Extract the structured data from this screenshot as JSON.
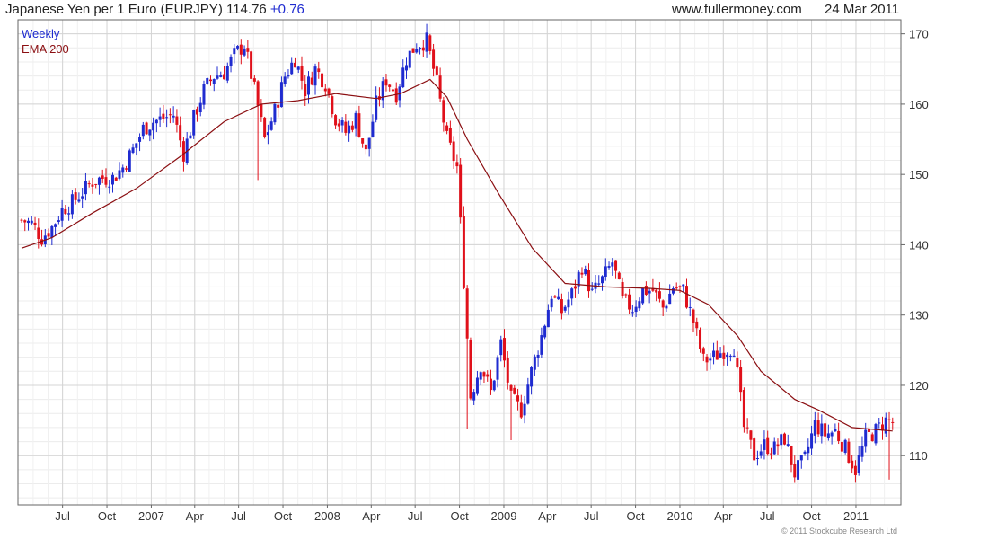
{
  "header": {
    "title": "Japanese Yen per 1 Euro (EURJPY)",
    "last": "114.76",
    "change": "+0.76",
    "site": "www.fullermoney.com",
    "date": "24 Mar 2011"
  },
  "footer": {
    "copyright": "© 2011 Stockcube Research Ltd"
  },
  "colors": {
    "up": "#1f2bd0",
    "down": "#e0101a",
    "ema": "#8b0f12",
    "grid": "#d4d4d4",
    "frame": "#666666"
  },
  "chart_data": {
    "type": "candlestick",
    "legend": [
      "Weekly",
      "EMA 200"
    ],
    "legend_position": "top-left",
    "grid": true,
    "ylim": [
      103,
      172
    ],
    "y_ticks": [
      110,
      120,
      130,
      140,
      150,
      160,
      170
    ],
    "x_ticks": [
      {
        "label": "Jul",
        "date": "2006-07-01"
      },
      {
        "label": "Oct",
        "date": "2006-10-01"
      },
      {
        "label": "2007",
        "date": "2007-01-01"
      },
      {
        "label": "Apr",
        "date": "2007-04-01"
      },
      {
        "label": "Jul",
        "date": "2007-07-01"
      },
      {
        "label": "Oct",
        "date": "2007-10-01"
      },
      {
        "label": "2008",
        "date": "2008-01-01"
      },
      {
        "label": "Apr",
        "date": "2008-04-01"
      },
      {
        "label": "Jul",
        "date": "2008-07-01"
      },
      {
        "label": "Oct",
        "date": "2008-10-01"
      },
      {
        "label": "2009",
        "date": "2009-01-01"
      },
      {
        "label": "Apr",
        "date": "2009-04-01"
      },
      {
        "label": "Jul",
        "date": "2009-07-01"
      },
      {
        "label": "Oct",
        "date": "2009-10-01"
      },
      {
        "label": "2010",
        "date": "2010-01-01"
      },
      {
        "label": "Apr",
        "date": "2010-04-01"
      },
      {
        "label": "Jul",
        "date": "2010-07-01"
      },
      {
        "label": "Oct",
        "date": "2010-10-01"
      },
      {
        "label": "2011",
        "date": "2011-01-01"
      }
    ],
    "close_path": [
      [
        "2006-04-07",
        143.5
      ],
      [
        "2006-04-28",
        143.0
      ],
      [
        "2006-05-19",
        141.0
      ],
      [
        "2006-06-09",
        142.5
      ],
      [
        "2006-06-30",
        145.0
      ],
      [
        "2006-07-21",
        146.0
      ],
      [
        "2006-08-11",
        147.5
      ],
      [
        "2006-09-01",
        149.0
      ],
      [
        "2006-09-22",
        149.5
      ],
      [
        "2006-10-13",
        149.5
      ],
      [
        "2006-11-03",
        151.0
      ],
      [
        "2006-11-24",
        153.5
      ],
      [
        "2006-12-15",
        156.5
      ],
      [
        "2007-01-05",
        157.5
      ],
      [
        "2007-01-26",
        158.0
      ],
      [
        "2007-02-16",
        158.5
      ],
      [
        "2007-03-09",
        153.0
      ],
      [
        "2007-03-30",
        158.0
      ],
      [
        "2007-04-20",
        162.0
      ],
      [
        "2007-05-11",
        164.0
      ],
      [
        "2007-06-01",
        164.5
      ],
      [
        "2007-06-22",
        167.0
      ],
      [
        "2007-07-13",
        168.5
      ],
      [
        "2007-08-03",
        162.0
      ],
      [
        "2007-08-24",
        155.0
      ],
      [
        "2007-09-14",
        159.0
      ],
      [
        "2007-10-05",
        164.0
      ],
      [
        "2007-10-26",
        166.5
      ],
      [
        "2007-11-16",
        162.0
      ],
      [
        "2007-12-07",
        165.0
      ],
      [
        "2007-12-28",
        163.0
      ],
      [
        "2008-01-18",
        158.0
      ],
      [
        "2008-02-08",
        156.0
      ],
      [
        "2008-02-29",
        158.0
      ],
      [
        "2008-03-21",
        153.0
      ],
      [
        "2008-04-11",
        160.0
      ],
      [
        "2008-05-02",
        163.5
      ],
      [
        "2008-05-23",
        161.5
      ],
      [
        "2008-06-13",
        166.5
      ],
      [
        "2008-07-04",
        168.5
      ],
      [
        "2008-07-25",
        169.0
      ],
      [
        "2008-08-15",
        163.0
      ],
      [
        "2008-09-05",
        155.0
      ],
      [
        "2008-09-26",
        151.0
      ],
      [
        "2008-10-10",
        135.0
      ],
      [
        "2008-10-24",
        118.5
      ],
      [
        "2008-11-14",
        123.0
      ],
      [
        "2008-12-05",
        119.0
      ],
      [
        "2008-12-26",
        126.0
      ],
      [
        "2009-01-16",
        118.0
      ],
      [
        "2009-02-06",
        116.5
      ],
      [
        "2009-02-27",
        122.0
      ],
      [
        "2009-03-20",
        127.0
      ],
      [
        "2009-04-10",
        133.0
      ],
      [
        "2009-05-01",
        130.5
      ],
      [
        "2009-05-22",
        133.0
      ],
      [
        "2009-06-12",
        137.0
      ],
      [
        "2009-07-03",
        133.0
      ],
      [
        "2009-07-24",
        135.0
      ],
      [
        "2009-08-14",
        137.5
      ],
      [
        "2009-09-04",
        132.0
      ],
      [
        "2009-09-25",
        131.0
      ],
      [
        "2009-10-16",
        133.5
      ],
      [
        "2009-11-06",
        133.5
      ],
      [
        "2009-11-27",
        131.0
      ],
      [
        "2009-12-18",
        134.0
      ],
      [
        "2010-01-08",
        133.5
      ],
      [
        "2010-01-29",
        129.0
      ],
      [
        "2010-02-19",
        123.5
      ],
      [
        "2010-03-12",
        124.0
      ],
      [
        "2010-04-02",
        125.0
      ],
      [
        "2010-04-23",
        125.5
      ],
      [
        "2010-05-14",
        114.0
      ],
      [
        "2010-06-04",
        110.0
      ],
      [
        "2010-06-25",
        111.5
      ],
      [
        "2010-07-16",
        111.0
      ],
      [
        "2010-08-06",
        112.5
      ],
      [
        "2010-08-27",
        107.5
      ],
      [
        "2010-09-17",
        109.5
      ],
      [
        "2010-10-08",
        114.5
      ],
      [
        "2010-10-29",
        113.0
      ],
      [
        "2010-11-19",
        113.5
      ],
      [
        "2010-12-10",
        111.0
      ],
      [
        "2010-12-31",
        108.0
      ],
      [
        "2011-01-21",
        112.5
      ],
      [
        "2011-02-11",
        113.5
      ],
      [
        "2011-03-04",
        115.0
      ],
      [
        "2011-03-18",
        114.76
      ]
    ],
    "ema_200": [
      [
        "2006-04-07",
        139.5
      ],
      [
        "2006-06-09",
        141.0
      ],
      [
        "2006-09-01",
        144.5
      ],
      [
        "2006-12-01",
        148.0
      ],
      [
        "2007-03-01",
        152.5
      ],
      [
        "2007-06-01",
        157.5
      ],
      [
        "2007-08-17",
        160.0
      ],
      [
        "2007-11-01",
        160.5
      ],
      [
        "2008-01-18",
        161.5
      ],
      [
        "2008-04-11",
        160.8
      ],
      [
        "2008-06-01",
        161.5
      ],
      [
        "2008-08-01",
        163.5
      ],
      [
        "2008-09-05",
        161.0
      ],
      [
        "2008-10-17",
        155.0
      ],
      [
        "2008-12-19",
        147.5
      ],
      [
        "2009-03-01",
        139.5
      ],
      [
        "2009-05-08",
        134.5
      ],
      [
        "2009-08-01",
        134.0
      ],
      [
        "2009-10-30",
        133.8
      ],
      [
        "2010-01-01",
        133.5
      ],
      [
        "2010-03-01",
        131.5
      ],
      [
        "2010-05-01",
        127.0
      ],
      [
        "2010-06-18",
        122.0
      ],
      [
        "2010-08-27",
        118.0
      ],
      [
        "2010-10-15",
        116.5
      ],
      [
        "2010-12-24",
        114.0
      ],
      [
        "2011-03-18",
        113.5
      ]
    ],
    "extreme_wicks": [
      [
        "2007-08-17",
        149.2
      ],
      [
        "2008-10-24",
        113.8
      ],
      [
        "2009-01-23",
        112.2
      ],
      [
        "2011-03-18",
        106.6
      ]
    ]
  }
}
